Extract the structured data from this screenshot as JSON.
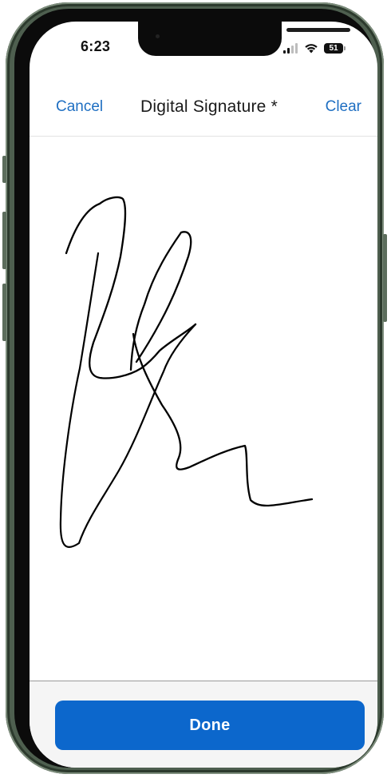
{
  "status_bar": {
    "time": "6:23",
    "battery_level": "51",
    "signal_bars": 2,
    "icons": [
      "cellular-signal-icon",
      "wifi-icon",
      "battery-icon"
    ]
  },
  "nav_bar": {
    "cancel_label": "Cancel",
    "title": "Digital Signature *",
    "clear_label": "Clear"
  },
  "signature_pad": {
    "has_signature": true,
    "ink_color": "#000000"
  },
  "footer": {
    "done_label": "Done"
  },
  "colors": {
    "accent": "#1f6fc2",
    "primary_button": "#0c67cc",
    "device_frame": "#4e5f4f"
  }
}
